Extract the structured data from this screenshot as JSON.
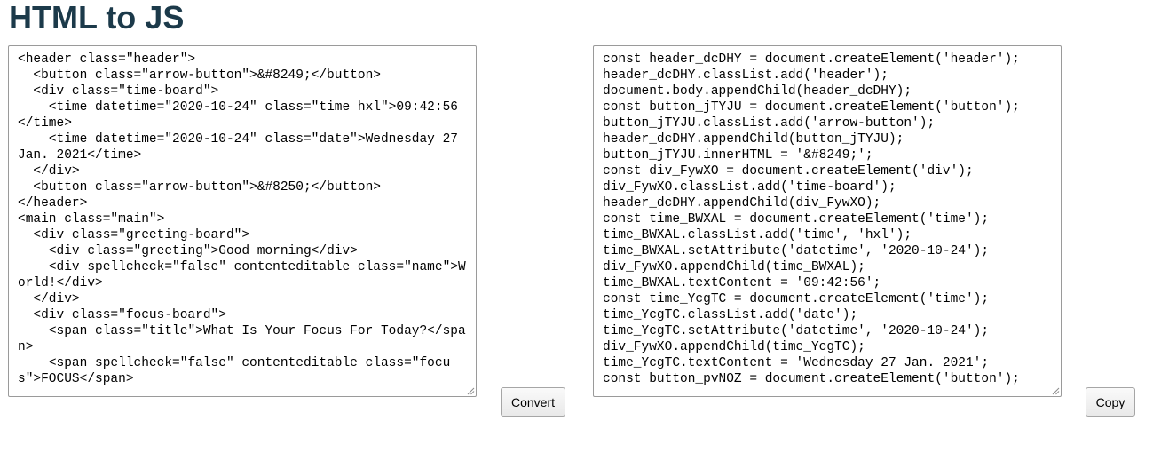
{
  "page": {
    "title": "HTML to JS"
  },
  "input": {
    "content": "<header class=\"header\">\n  <button class=\"arrow-button\">&#8249;</button>\n  <div class=\"time-board\">\n    <time datetime=\"2020-10-24\" class=\"time hxl\">09:42:56</time>\n    <time datetime=\"2020-10-24\" class=\"date\">Wednesday 27 Jan. 2021</time>\n  </div>\n  <button class=\"arrow-button\">&#8250;</button>\n</header>\n<main class=\"main\">\n  <div class=\"greeting-board\">\n    <div class=\"greeting\">Good morning</div>\n    <div spellcheck=\"false\" contenteditable class=\"name\">World!</div>\n  </div>\n  <div class=\"focus-board\">\n    <span class=\"title\">What Is Your Focus For Today?</span>\n    <span spellcheck=\"false\" contenteditable class=\"focus\">FOCUS</span>"
  },
  "output": {
    "content": "const header_dcDHY = document.createElement('header');\nheader_dcDHY.classList.add('header');\ndocument.body.appendChild(header_dcDHY);\nconst button_jTYJU = document.createElement('button');\nbutton_jTYJU.classList.add('arrow-button');\nheader_dcDHY.appendChild(button_jTYJU);\nbutton_jTYJU.innerHTML = '&#8249;';\nconst div_FywXO = document.createElement('div');\ndiv_FywXO.classList.add('time-board');\nheader_dcDHY.appendChild(div_FywXO);\nconst time_BWXAL = document.createElement('time');\ntime_BWXAL.classList.add('time', 'hxl');\ntime_BWXAL.setAttribute('datetime', '2020-10-24');\ndiv_FywXO.appendChild(time_BWXAL);\ntime_BWXAL.textContent = '09:42:56';\nconst time_YcgTC = document.createElement('time');\ntime_YcgTC.classList.add('date');\ntime_YcgTC.setAttribute('datetime', '2020-10-24');\ndiv_FywXO.appendChild(time_YcgTC);\ntime_YcgTC.textContent = 'Wednesday 27 Jan. 2021';\nconst button_pvNOZ = document.createElement('button');"
  },
  "buttons": {
    "convert_label": "Convert",
    "copy_label": "Copy"
  },
  "icons": {
    "resize": "resize-grip-icon"
  },
  "colors": {
    "title": "#1c3a4a",
    "border": "#9a9a9a"
  }
}
